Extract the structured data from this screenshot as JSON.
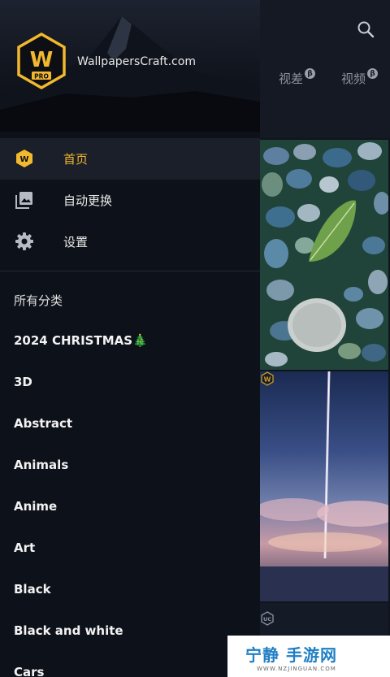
{
  "app_background": {
    "tabs": [
      {
        "label": "视差",
        "badge": "β"
      },
      {
        "label": "视频",
        "badge": "β"
      }
    ],
    "search_icon": "search-icon",
    "card_badges": [
      "W",
      "W",
      "UC"
    ]
  },
  "drawer": {
    "app_name": "WallpapersCraft.com",
    "logo": {
      "letter": "W",
      "sub": "PRO"
    },
    "nav": [
      {
        "label": "首页",
        "icon": "wallpapers-craft-icon",
        "active": true
      },
      {
        "label": "自动更换",
        "icon": "image-stack-icon",
        "active": false
      },
      {
        "label": "设置",
        "icon": "gear-icon",
        "active": false
      }
    ],
    "categories_header": "所有分类",
    "categories": [
      "2024 CHRISTMAS🎄",
      "3D",
      "Abstract",
      "Animals",
      "Anime",
      "Art",
      "Black",
      "Black and white",
      "Cars"
    ]
  },
  "watermark": {
    "title": "宁静 手游网",
    "subtitle": "WWW.NZJINGUAN.COM"
  },
  "colors": {
    "accent": "#f2b82e",
    "drawer_bg": "#0d1119",
    "active_row": "#1b1f29"
  }
}
